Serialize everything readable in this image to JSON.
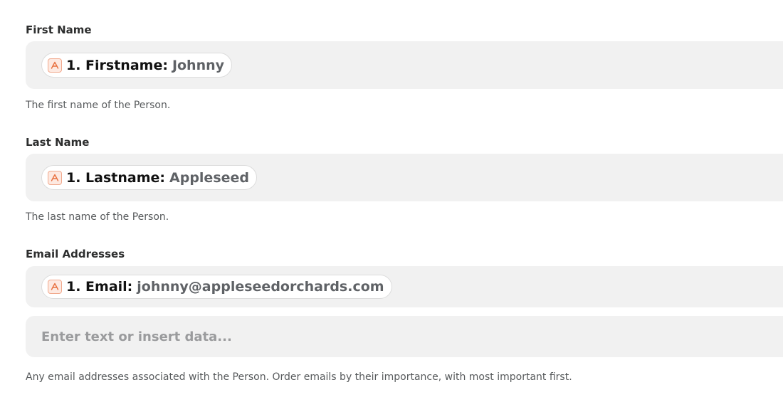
{
  "fields": {
    "first_name": {
      "label": "First Name",
      "pill_key": "1. Firstname:",
      "pill_value": "Johnny",
      "help": "The first name of the Person."
    },
    "last_name": {
      "label": "Last Name",
      "pill_key": "1. Lastname:",
      "pill_value": "Appleseed",
      "help": "The last name of the Person."
    },
    "email": {
      "label": "Email Addresses",
      "pill_key": "1. Email:",
      "pill_value": "johnny@appleseedorchards.com",
      "input_placeholder": "Enter text or insert data...",
      "help": "Any email addresses associated with the Person. Order emails by their importance, with most important first."
    }
  },
  "colors": {
    "field_background": "#f1f1f1",
    "app_icon_accent": "#e8703f"
  },
  "icons": {
    "pill_icon": "app-logo-icon"
  }
}
